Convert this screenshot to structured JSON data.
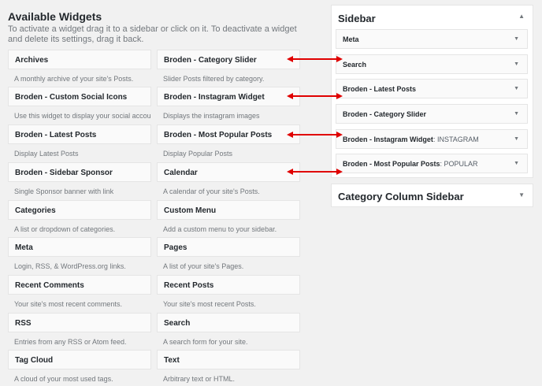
{
  "available": {
    "title": "Available Widgets",
    "description": "To activate a widget drag it to a sidebar or click on it. To deactivate a widget and delete its settings, drag it back."
  },
  "widgets": [
    {
      "title": "Archives",
      "desc": "A monthly archive of your site's Posts."
    },
    {
      "title": "Broden - Category Slider",
      "desc": "Slider Posts filtered by category."
    },
    {
      "title": "Broden - Custom Social Icons",
      "desc": "Use this widget to display your social accounts."
    },
    {
      "title": "Broden - Instagram Widget",
      "desc": "Displays the instagram images"
    },
    {
      "title": "Broden - Latest Posts",
      "desc": "Display Latest Posts"
    },
    {
      "title": "Broden - Most Popular Posts",
      "desc": "Display Popular Posts"
    },
    {
      "title": "Broden - Sidebar Sponsor",
      "desc": "Single Sponsor banner with link"
    },
    {
      "title": "Calendar",
      "desc": "A calendar of your site's Posts."
    },
    {
      "title": "Categories",
      "desc": "A list or dropdown of categories."
    },
    {
      "title": "Custom Menu",
      "desc": "Add a custom menu to your sidebar."
    },
    {
      "title": "Meta",
      "desc": "Login, RSS, & WordPress.org links."
    },
    {
      "title": "Pages",
      "desc": "A list of your site's Pages."
    },
    {
      "title": "Recent Comments",
      "desc": "Your site's most recent comments."
    },
    {
      "title": "Recent Posts",
      "desc": "Your site's most recent Posts."
    },
    {
      "title": "RSS",
      "desc": "Entries from any RSS or Atom feed."
    },
    {
      "title": "Search",
      "desc": "A search form for your site."
    },
    {
      "title": "Tag Cloud",
      "desc": "A cloud of your most used tags."
    },
    {
      "title": "Text",
      "desc": "Arbitrary text or HTML."
    }
  ],
  "sidebar": {
    "title": "Sidebar",
    "widgets": [
      {
        "title": "Meta",
        "extra": ""
      },
      {
        "title": "Search",
        "extra": ""
      },
      {
        "title": "Broden - Latest Posts",
        "extra": ""
      },
      {
        "title": "Broden - Category Slider",
        "extra": ""
      },
      {
        "title": "Broden - Instagram Widget",
        "extra": ": INSTAGRAM"
      },
      {
        "title": "Broden - Most Popular Posts",
        "extra": ": POPULAR"
      }
    ]
  },
  "category_sidebar": {
    "title": "Category Column Sidebar"
  },
  "icons": {
    "collapse": "triangle-up-icon",
    "expand": "triangle-down-icon"
  },
  "colors": {
    "annotation_arrow": "#e00000"
  }
}
